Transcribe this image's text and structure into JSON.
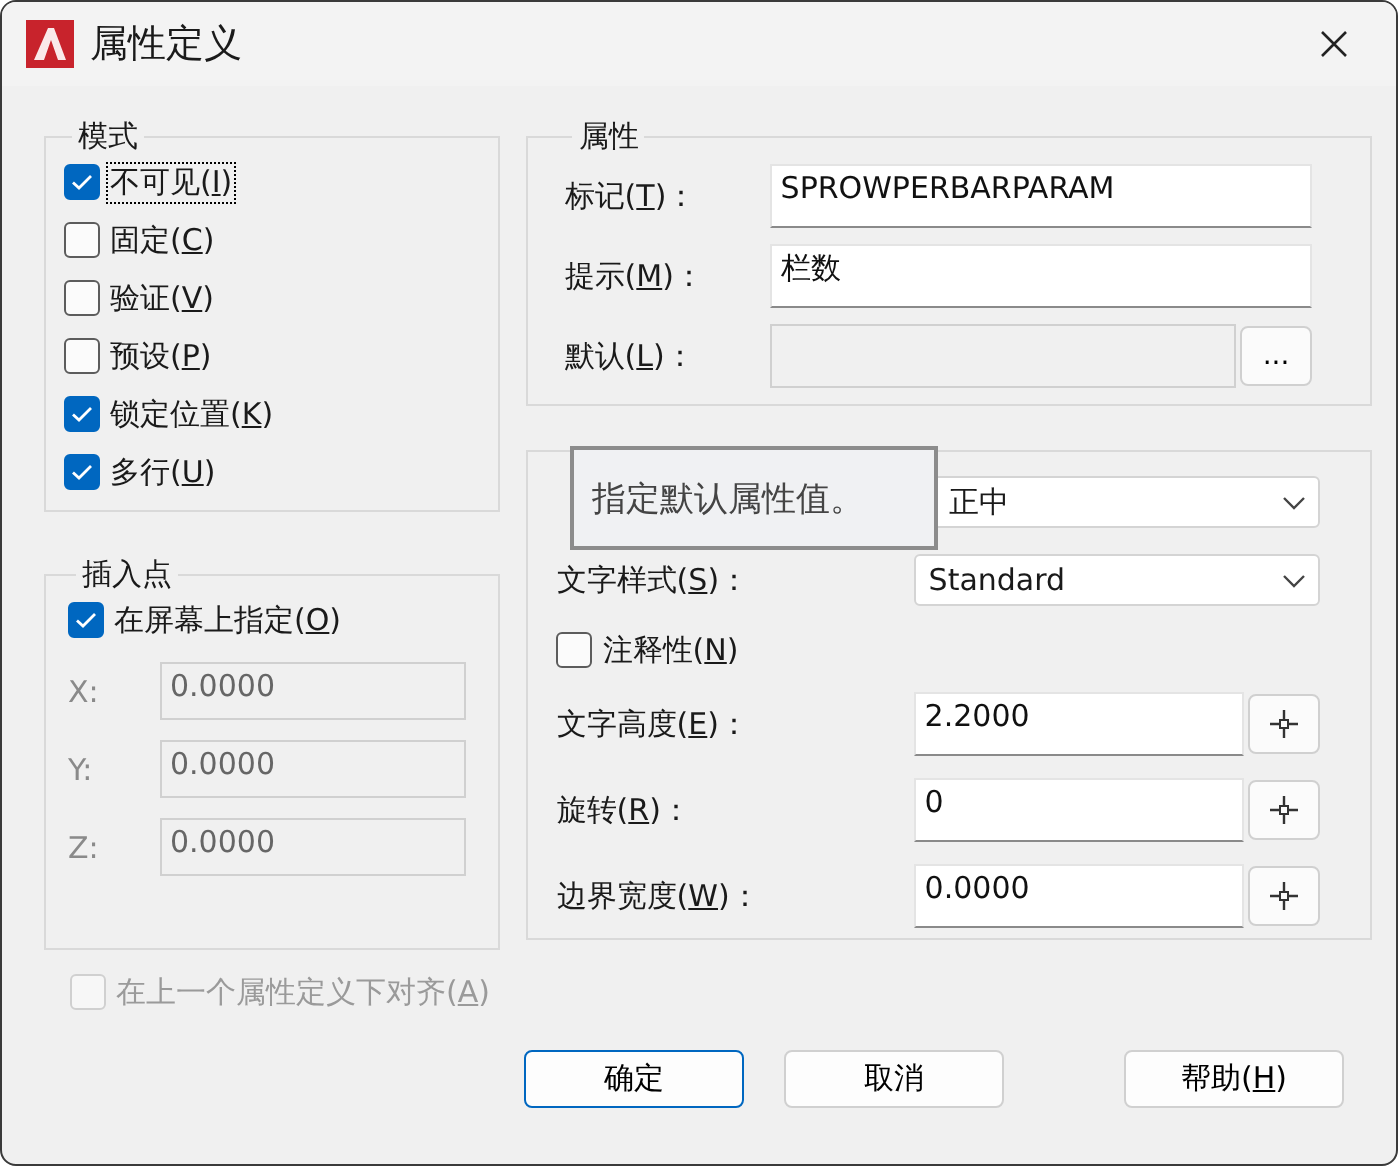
{
  "window": {
    "title": "属性定义"
  },
  "mode": {
    "title": "模式",
    "options": [
      {
        "label": "不可见(I)",
        "checked": true,
        "focused": true
      },
      {
        "label": "固定(C)",
        "checked": false,
        "focused": false
      },
      {
        "label": "验证(V)",
        "checked": false,
        "focused": false
      },
      {
        "label": "预设(P)",
        "checked": false,
        "focused": false
      },
      {
        "label": "锁定位置(K)",
        "checked": true,
        "focused": false
      },
      {
        "label": "多行(U)",
        "checked": true,
        "focused": false
      }
    ]
  },
  "insertion_point": {
    "title": "插入点",
    "on_screen": {
      "label": "在屏幕上指定(O)",
      "checked": true
    },
    "coords": [
      {
        "label": "X:",
        "value": "0.0000",
        "disabled": true
      },
      {
        "label": "Y:",
        "value": "0.0000",
        "disabled": true
      },
      {
        "label": "Z:",
        "value": "0.0000",
        "disabled": true
      }
    ]
  },
  "attribute": {
    "title": "属性",
    "fields": [
      {
        "kind": "text",
        "label": "标记(T)：",
        "value": "SPROWPERBARPARAM"
      },
      {
        "kind": "text",
        "label": "提示(M)：",
        "value": "栏数"
      },
      {
        "kind": "browse",
        "label": "默认(L)：",
        "button": "...",
        "disabled": true
      }
    ]
  },
  "text_settings": {
    "rows": [
      {
        "kind": "select",
        "value": "正中"
      },
      {
        "kind": "select",
        "label": "文字样式(S)：",
        "value": "Standard"
      },
      {
        "kind": "checkbox",
        "label": "注释性(N)",
        "checked": false
      },
      {
        "kind": "pick",
        "label": "文字高度(E)：",
        "value": "2.2000"
      },
      {
        "kind": "pick",
        "label": "旋转(R)：",
        "value": "0"
      },
      {
        "kind": "pick",
        "label": "边界宽度(W)：",
        "value": "0.0000"
      }
    ]
  },
  "align_below": {
    "label": "在上一个属性定义下对齐(A)",
    "checked": false,
    "disabled": true
  },
  "buttons": [
    {
      "label": "确定",
      "default": true
    },
    {
      "label": "取消",
      "default": false
    },
    {
      "label": "帮助(H)",
      "default": false
    }
  ],
  "tooltip": "指定默认属性值。"
}
